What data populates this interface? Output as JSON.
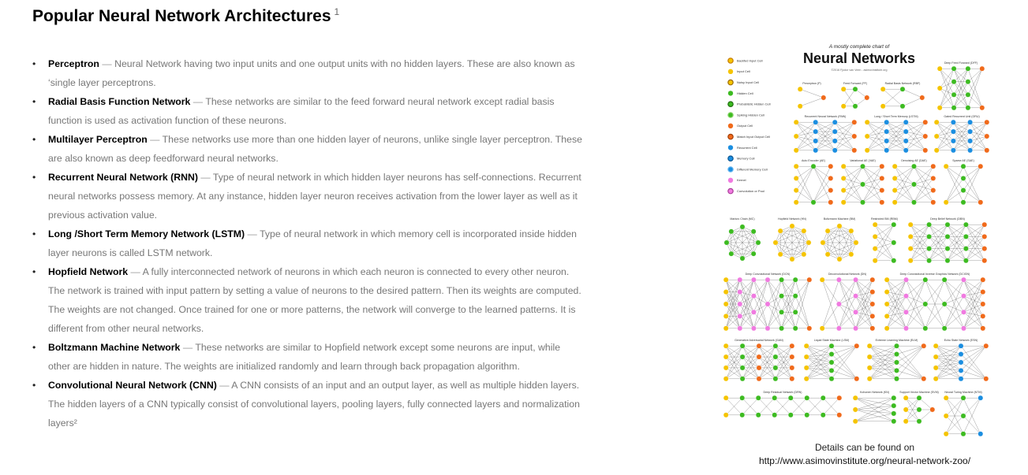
{
  "header": {
    "title": "Popular Neural Network Architectures",
    "footnote_marker": "1"
  },
  "architectures": [
    {
      "term": "Perceptron",
      "description": "Neural Network having two input units and one output units with no hidden layers. These are also known as ‘single layer perceptrons."
    },
    {
      "term": "Radial Basis Function Network",
      "description": "These networks are similar to the feed forward neural network except radial basis function is used as activation function of these neurons."
    },
    {
      "term": "Multilayer Perceptron",
      "description": "These networks use more than one hidden layer of neurons, unlike single layer perceptron. These are also known as deep feedforward neural networks."
    },
    {
      "term": "Recurrent Neural Network (RNN)",
      "description": "Type of neural network in which hidden layer neurons has self-connections. Recurrent neural networks possess memory. At any instance, hidden layer neuron receives activation from the lower layer as well as it previous activation value."
    },
    {
      "term": "Long /Short Term Memory Network (LSTM)",
      "description": "Type of neural network in which memory cell is incorporated inside hidden layer neurons is called LSTM network."
    },
    {
      "term": "Hopfield Network",
      "description": "A fully interconnected network of neurons in which each neuron is connected to every other neuron. The network is trained with input pattern by setting a value of neurons to the desired pattern. Then its weights are computed. The weights are not changed. Once trained for one or more patterns, the network will converge to the learned patterns. It is different from other neural networks."
    },
    {
      "term": "Boltzmann Machine Network",
      "description": "These networks are similar to Hopfield network except some neurons are input, while other are hidden in nature. The weights are initialized randomly and learn through back propagation algorithm."
    },
    {
      "term": "Convolutional Neural Network (CNN)",
      "description": "A CNN consists of an input and an output layer, as well as multiple hidden layers. The hidden layers of a CNN typically consist of convolutional layers, pooling layers, fully connected layers and normalization layers²"
    }
  ],
  "chart": {
    "kicker": "A mostly complete chart of",
    "title": "Neural Networks",
    "credit": "©2016 Fjodor van Veen - asimovinstitute.org",
    "legend": [
      {
        "label": "Backfed Input Cell",
        "color": "#f5c400",
        "ring": "#c47800"
      },
      {
        "label": "Input Cell",
        "color": "#f5c400",
        "ring": ""
      },
      {
        "label": "Noisy Input Cell",
        "color": "#f5c400",
        "ring": "#9a6a00"
      },
      {
        "label": "Hidden Cell",
        "color": "#3dbb21",
        "ring": ""
      },
      {
        "label": "Probablistic Hidden Cell",
        "color": "#3dbb21",
        "ring": "#1f6e0e"
      },
      {
        "label": "Spiking Hidden Cell",
        "color": "#3dbb21",
        "ring": "#8ad36a"
      },
      {
        "label": "Output Cell",
        "color": "#f06a1b",
        "ring": ""
      },
      {
        "label": "Match Input Output Cell",
        "color": "#f06a1b",
        "ring": "#a13d05"
      },
      {
        "label": "Recurrent Cell",
        "color": "#1b8ee0",
        "ring": ""
      },
      {
        "label": "Memory Cell",
        "color": "#1b8ee0",
        "ring": "#0b5591"
      },
      {
        "label": "Different Memory Cell",
        "color": "#1b8ee0",
        "ring": "#67b6f0"
      },
      {
        "label": "Kernel",
        "color": "#f07ae0",
        "ring": ""
      },
      {
        "label": "Convolution or Pool",
        "color": "#f07ae0",
        "ring": "#a93c98"
      }
    ],
    "networks": [
      {
        "name": "Perceptron (P)",
        "layers": [
          2,
          1
        ],
        "colors": [
          "#f5c400",
          "#f06a1b"
        ]
      },
      {
        "name": "Feed Forward (FF)",
        "layers": [
          2,
          2,
          1
        ],
        "colors": [
          "#f5c400",
          "#3dbb21",
          "#f06a1b"
        ]
      },
      {
        "name": "Radial Basis Network (RBF)",
        "layers": [
          2,
          2,
          1
        ],
        "colors": [
          "#f5c400",
          "#3dbb21",
          "#f06a1b"
        ]
      },
      {
        "name": "Deep Feed Forward (DFF)",
        "layers": [
          3,
          4,
          4,
          2
        ],
        "colors": [
          "#f5c400",
          "#3dbb21",
          "#3dbb21",
          "#f06a1b"
        ]
      },
      {
        "name": "Recurrent Neural Network (RNN)",
        "layers": [
          3,
          4,
          4,
          3
        ],
        "colors": [
          "#f5c400",
          "#1b8ee0",
          "#1b8ee0",
          "#f06a1b"
        ]
      },
      {
        "name": "Long / Short Term Memory (LSTM)",
        "layers": [
          3,
          4,
          4,
          3
        ],
        "colors": [
          "#f5c400",
          "#1b8ee0",
          "#1b8ee0",
          "#f06a1b"
        ]
      },
      {
        "name": "Gated Recurrent Unit (GRU)",
        "layers": [
          3,
          4,
          4,
          3
        ],
        "colors": [
          "#f5c400",
          "#1b8ee0",
          "#1b8ee0",
          "#f06a1b"
        ]
      },
      {
        "name": "Auto Encoder (AE)",
        "layers": [
          4,
          2,
          4
        ],
        "colors": [
          "#f5c400",
          "#3dbb21",
          "#f06a1b"
        ]
      },
      {
        "name": "Variational AE (VAE)",
        "layers": [
          4,
          3,
          4
        ],
        "colors": [
          "#f5c400",
          "#3dbb21",
          "#f06a1b"
        ]
      },
      {
        "name": "Denoising AE (DAE)",
        "layers": [
          4,
          3,
          4
        ],
        "colors": [
          "#f5c400",
          "#3dbb21",
          "#f06a1b"
        ]
      },
      {
        "name": "Sparse AE (SAE)",
        "layers": [
          2,
          4,
          2
        ],
        "colors": [
          "#f5c400",
          "#3dbb21",
          "#f06a1b"
        ]
      },
      {
        "name": "Markov Chain (MC)",
        "layers": [
          8
        ],
        "colors": [
          "#3dbb21"
        ]
      },
      {
        "name": "Hopfield Network (HN)",
        "layers": [
          8
        ],
        "colors": [
          "#f5c400"
        ]
      },
      {
        "name": "Boltzmann Machine (BM)",
        "layers": [
          8
        ],
        "colors": [
          "#f5c400"
        ]
      },
      {
        "name": "Restricted BM (RBM)",
        "layers": [
          4,
          3
        ],
        "colors": [
          "#f5c400",
          "#3dbb21"
        ]
      },
      {
        "name": "Deep Belief Network (DBN)",
        "layers": [
          4,
          4,
          4,
          4,
          4
        ],
        "colors": [
          "#f5c400",
          "#3dbb21",
          "#3dbb21",
          "#3dbb21",
          "#f06a1b"
        ]
      },
      {
        "name": "Deep Convolutional Network (DCN)",
        "layers": [
          5,
          5,
          4,
          3,
          4,
          4,
          2
        ],
        "colors": [
          "#f5c400",
          "#f07ae0",
          "#f07ae0",
          "#f07ae0",
          "#3dbb21",
          "#3dbb21",
          "#f06a1b"
        ]
      },
      {
        "name": "Deconvolutional Network (DN)",
        "layers": [
          2,
          3,
          4,
          5
        ],
        "colors": [
          "#f5c400",
          "#f07ae0",
          "#f07ae0",
          "#f06a1b"
        ]
      },
      {
        "name": "Deep Convolutional Inverse Graphics Network (DCIGN)",
        "layers": [
          5,
          4,
          3,
          3,
          4,
          5
        ],
        "colors": [
          "#f5c400",
          "#f07ae0",
          "#3dbb21",
          "#3dbb21",
          "#f07ae0",
          "#f06a1b"
        ]
      },
      {
        "name": "Generative Adversarial Network (GAN)",
        "layers": [
          4,
          4,
          4,
          4,
          4
        ],
        "colors": [
          "#f5c400",
          "#3dbb21",
          "#f06a1b",
          "#3dbb21",
          "#f06a1b"
        ]
      },
      {
        "name": "Liquid State Machine (LSM)",
        "layers": [
          4,
          5,
          2
        ],
        "colors": [
          "#f5c400",
          "#3dbb21",
          "#f06a1b"
        ]
      },
      {
        "name": "Extreme Learning Machine (ELM)",
        "layers": [
          4,
          5,
          2
        ],
        "colors": [
          "#f5c400",
          "#3dbb21",
          "#f06a1b"
        ]
      },
      {
        "name": "Echo State Network (ESN)",
        "layers": [
          4,
          5,
          2
        ],
        "colors": [
          "#f5c400",
          "#1b8ee0",
          "#f06a1b"
        ]
      },
      {
        "name": "Deep Residual Network (DRN)",
        "layers": [
          2,
          2,
          2,
          2,
          2,
          2,
          2,
          2
        ],
        "colors": [
          "#f5c400",
          "#3dbb21",
          "#3dbb21",
          "#3dbb21",
          "#3dbb21",
          "#3dbb21",
          "#3dbb21",
          "#f06a1b"
        ]
      },
      {
        "name": "Kohonen Network (KN)",
        "layers": [
          3,
          4
        ],
        "colors": [
          "#f5c400",
          "#3dbb21"
        ]
      },
      {
        "name": "Support Vector Machine (SVM)",
        "layers": [
          3,
          3,
          1
        ],
        "colors": [
          "#f5c400",
          "#3dbb21",
          "#f06a1b"
        ]
      },
      {
        "name": "Neural Turing Machine (NTM)",
        "layers": [
          3,
          3,
          2
        ],
        "colors": [
          "#f5c400",
          "#3dbb21",
          "#1b8ee0"
        ]
      }
    ]
  },
  "caption": {
    "line1": "Details can be found on",
    "url": "http://www.asimovinstitute.org/neural-network-zoo/"
  }
}
